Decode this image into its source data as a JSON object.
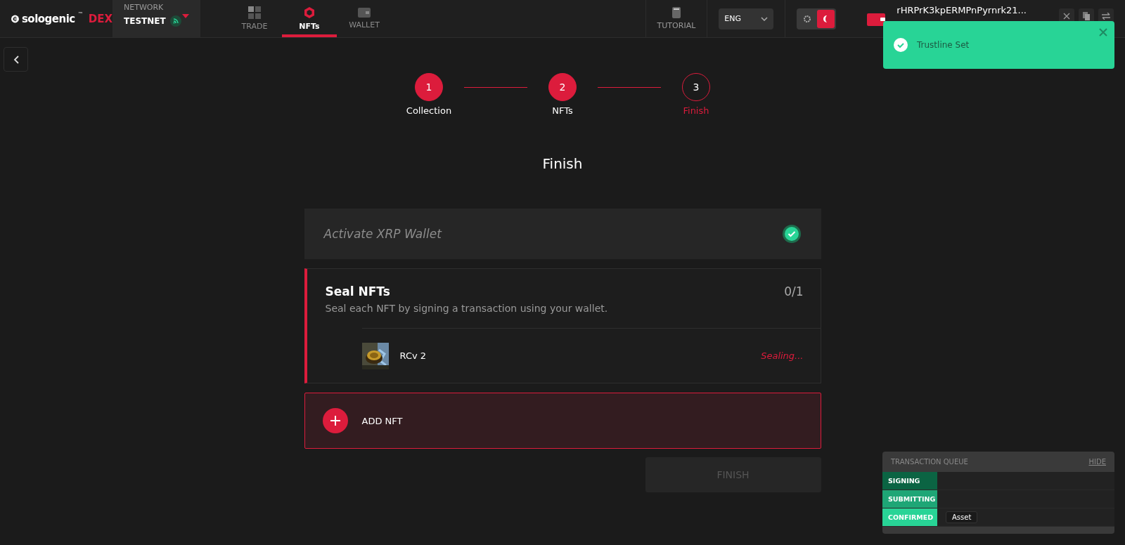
{
  "header": {
    "logo": {
      "brand": "sologenic",
      "trademark": "™",
      "product": "DEX"
    },
    "network": {
      "label": "NETWORK",
      "value": "TESTNET",
      "connected": true
    },
    "nav": [
      {
        "label": "TRADE",
        "selected": false
      },
      {
        "label": "NFTs",
        "selected": true
      },
      {
        "label": "WALLET",
        "selected": false
      }
    ],
    "tutorial": "TUTORIAL",
    "language": "ENG",
    "dark_mode": true,
    "wallet_address": "rHRPrK3kpERMPnPyrnrk21..."
  },
  "toast": {
    "message": "Trustline Set"
  },
  "stepper": [
    {
      "number": "1",
      "label": "Collection",
      "completed": true,
      "selected": false
    },
    {
      "number": "2",
      "label": "NFTs",
      "completed": true,
      "selected": false
    },
    {
      "number": "3",
      "label": "Finish",
      "completed": false,
      "selected": true
    }
  ],
  "heading": "Finish",
  "activate": {
    "title": "Activate XRP Wallet",
    "done": true
  },
  "seal": {
    "title": "Seal NFTs",
    "description": "Seal each NFT by signing a transaction using your wallet.",
    "count": "0/1",
    "active": true,
    "items": [
      {
        "name": "RCv 2",
        "status": "Sealing..."
      }
    ]
  },
  "add_nft": "ADD NFT",
  "finish_button": {
    "label": "FINISH",
    "disabled": true
  },
  "queue": {
    "title": "TRANSACTION QUEUE",
    "hide": "HIDE",
    "stages": [
      {
        "label": "SIGNING",
        "color": "#0b6443"
      },
      {
        "label": "SUBMITTING",
        "color": "#1ea676"
      },
      {
        "label": "CONFIRMED",
        "color": "#28d496",
        "chips": [
          "Asset"
        ]
      }
    ]
  }
}
